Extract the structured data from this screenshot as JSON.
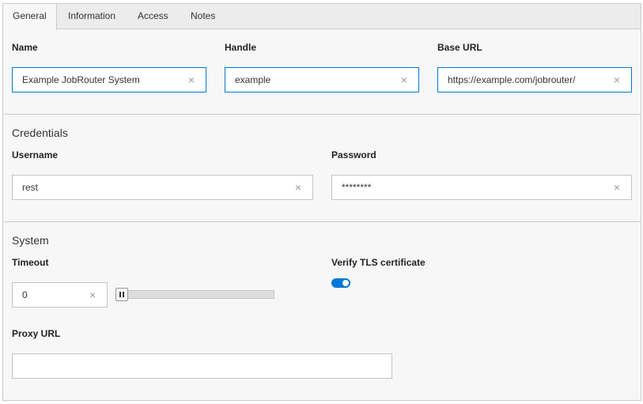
{
  "tabs": [
    {
      "label": "General",
      "active": true
    },
    {
      "label": "Information",
      "active": false
    },
    {
      "label": "Access",
      "active": false
    },
    {
      "label": "Notes",
      "active": false
    }
  ],
  "general": {
    "name_label": "Name",
    "name_value": "Example JobRouter System",
    "handle_label": "Handle",
    "handle_value": "example",
    "base_url_label": "Base URL",
    "base_url_value": "https://example.com/jobrouter/"
  },
  "credentials": {
    "title": "Credentials",
    "username_label": "Username",
    "username_value": "rest",
    "password_label": "Password",
    "password_value": "********"
  },
  "system": {
    "title": "System",
    "timeout_label": "Timeout",
    "timeout_value": "0",
    "timeout_slider_fraction": 0,
    "verify_tls_label": "Verify TLS certificate",
    "verify_tls_enabled": true,
    "proxy_url_label": "Proxy URL",
    "proxy_url_value": ""
  },
  "icons": {
    "clear": "close-icon"
  },
  "colors": {
    "accent": "#0078d7",
    "border": "#cccccc",
    "panel": "#f7f7f7"
  },
  "clear_glyph": "×"
}
